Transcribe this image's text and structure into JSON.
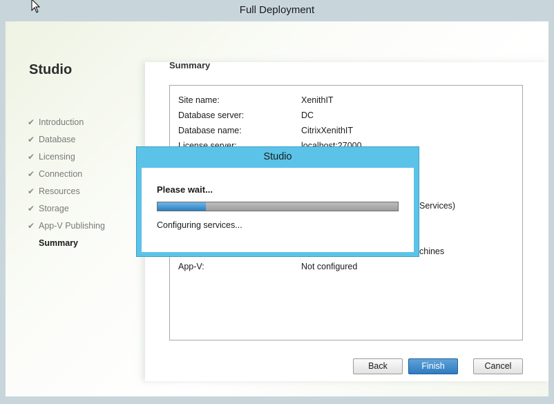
{
  "window": {
    "title": "Full Deployment"
  },
  "nav": {
    "title": "Studio",
    "items": [
      {
        "label": "Introduction",
        "done": true
      },
      {
        "label": "Database",
        "done": true
      },
      {
        "label": "Licensing",
        "done": true
      },
      {
        "label": "Connection",
        "done": true
      },
      {
        "label": "Resources",
        "done": true
      },
      {
        "label": "Storage",
        "done": true
      },
      {
        "label": "App-V Publishing",
        "done": true
      }
    ],
    "current": "Summary"
  },
  "summary": {
    "heading": "Summary",
    "rows": [
      {
        "key": "Site name:",
        "value": "XenithIT"
      },
      {
        "key": "Database server:",
        "value": "DC"
      },
      {
        "key": "Database name:",
        "value": "CitrixXenithIT"
      },
      {
        "key": "License server:",
        "value": "localhost:27000"
      }
    ],
    "partial_1": "Services)",
    "partial_2": "chines",
    "last_row": {
      "key": "App-V:",
      "value": "Not configured"
    }
  },
  "buttons": {
    "back": "Back",
    "finish": "Finish",
    "cancel": "Cancel"
  },
  "dialog": {
    "title": "Studio",
    "heading": "Please wait...",
    "progress_fraction": 0.2,
    "status": "Configuring services..."
  },
  "icons": {
    "check": "checkmark-icon",
    "cursor": "mouse-pointer-icon"
  }
}
